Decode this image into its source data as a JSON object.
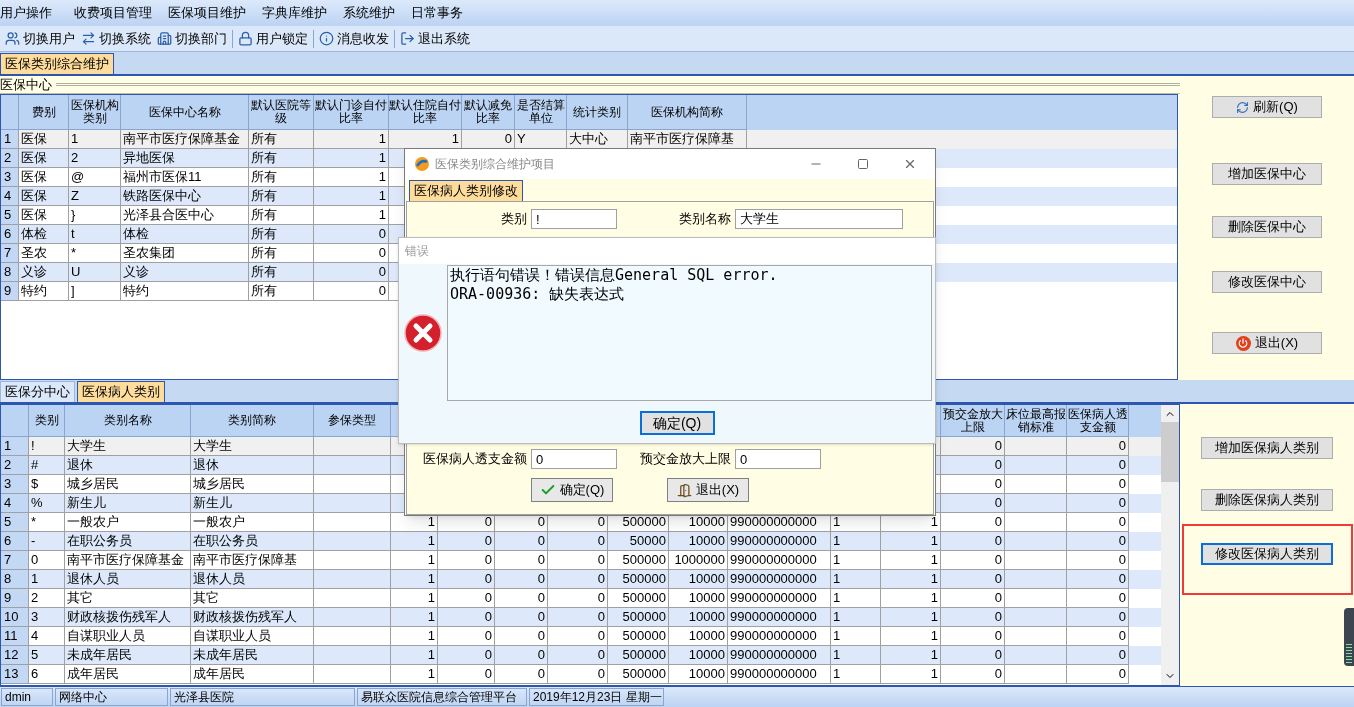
{
  "menu": [
    "用户操作",
    "收费项目管理",
    "医保项目维护",
    "字典库维护",
    "系统维护",
    "日常事务"
  ],
  "toolbar": [
    "切换用户",
    "切换系统",
    "切换部门",
    "用户锁定",
    "消息收发",
    "退出系统"
  ],
  "main_tabs": [
    {
      "label": "医保类别综合维护",
      "selected": true
    }
  ],
  "center_group": {
    "title": "医保中心",
    "columns": [
      "费别",
      "医保机构类别",
      "医保中心名称",
      "默认医院等级",
      "默认门诊自付比率",
      "默认住院自付比率",
      "默认减免比率",
      "是否结算单位",
      "统计类别",
      "医保机构简称"
    ],
    "rows": [
      {
        "no": "1",
        "selected": true,
        "cells": [
          "医保",
          "1",
          "南平市医疗保障基金",
          "所有",
          "1",
          "1",
          "0",
          "Y",
          "大中心",
          "南平市医疗保障基"
        ]
      },
      {
        "no": "2",
        "selected": false,
        "cells": [
          "医保",
          "2",
          "异地医保",
          "所有",
          "1"
        ]
      },
      {
        "no": "3",
        "selected": false,
        "cells": [
          "医保",
          "@",
          "福州市医保11",
          "所有",
          "1"
        ]
      },
      {
        "no": "4",
        "selected": false,
        "cells": [
          "医保",
          "Z",
          "铁路医保中心",
          "所有",
          "1"
        ]
      },
      {
        "no": "5",
        "selected": false,
        "cells": [
          "医保",
          "}",
          "光泽县合医中心",
          "所有",
          "1"
        ]
      },
      {
        "no": "6",
        "selected": false,
        "cells": [
          "体检",
          "t",
          "体检",
          "所有",
          "0"
        ]
      },
      {
        "no": "7",
        "selected": false,
        "cells": [
          "圣农",
          "*",
          "圣农集团",
          "所有",
          "0"
        ]
      },
      {
        "no": "8",
        "selected": false,
        "cells": [
          "义诊",
          "U",
          "义诊",
          "所有",
          "0"
        ]
      },
      {
        "no": "9",
        "selected": false,
        "cells": [
          "特约",
          "]",
          "特约",
          "所有",
          "0"
        ]
      }
    ],
    "buttons": [
      {
        "label": "刷新(Q)",
        "kind": "refresh"
      },
      {
        "label": "增加医保中心",
        "kind": "plain"
      },
      {
        "label": "删除医保中心",
        "kind": "plain"
      },
      {
        "label": "修改医保中心",
        "kind": "plain"
      },
      {
        "label": "退出(X)",
        "kind": "exit"
      }
    ]
  },
  "lower_tabs": [
    {
      "label": "医保分中心",
      "selected": false
    },
    {
      "label": "医保病人类别",
      "selected": true
    }
  ],
  "patient_types": {
    "columns": [
      "类别",
      "类别名称",
      "类别简称",
      "参保类型",
      null,
      null,
      null,
      null,
      null,
      null,
      null,
      null,
      null,
      "预交金放大上限",
      "床位最高报销标准",
      "医保病人透支金额"
    ],
    "rows": [
      {
        "no": "1",
        "selected": true,
        "cells": [
          "!",
          "大学生",
          "大学生",
          null,
          null,
          null,
          null,
          null,
          null,
          null,
          null,
          null,
          null,
          "0",
          null,
          "0"
        ]
      },
      {
        "no": "2",
        "selected": false,
        "cells": [
          "#",
          "退休",
          "退休",
          null,
          null,
          null,
          null,
          null,
          null,
          null,
          null,
          null,
          null,
          "0",
          null,
          "0"
        ]
      },
      {
        "no": "3",
        "selected": false,
        "cells": [
          "$",
          "城乡居民",
          "城乡居民",
          null,
          null,
          null,
          null,
          null,
          null,
          null,
          null,
          null,
          null,
          "0",
          null,
          "0"
        ]
      },
      {
        "no": "4",
        "selected": false,
        "cells": [
          "%",
          "新生儿",
          "新生儿",
          null,
          null,
          null,
          null,
          null,
          null,
          null,
          null,
          null,
          null,
          "0",
          null,
          "0"
        ]
      },
      {
        "no": "5",
        "selected": false,
        "cells": [
          "*",
          "一般农户",
          "一般农户",
          null,
          "1",
          "0",
          "0",
          "0",
          "500000",
          "10000",
          "990000000000",
          "1",
          "1",
          "0",
          null,
          "0"
        ]
      },
      {
        "no": "6",
        "selected": false,
        "cells": [
          "-",
          "在职公务员",
          "在职公务员",
          null,
          "1",
          "0",
          "0",
          "0",
          "50000",
          "10000",
          "990000000000",
          "1",
          "1",
          "0",
          null,
          "0"
        ]
      },
      {
        "no": "7",
        "selected": false,
        "cells": [
          "0",
          "南平市医疗保障基金",
          "南平市医疗保障基",
          null,
          "1",
          "0",
          "0",
          "0",
          "500000",
          "1000000",
          "990000000000",
          "1",
          "1",
          "0",
          null,
          "0"
        ]
      },
      {
        "no": "8",
        "selected": false,
        "cells": [
          "1",
          "退休人员",
          "退休人员",
          null,
          "1",
          "0",
          "0",
          "0",
          "500000",
          "10000",
          "990000000000",
          "1",
          "1",
          "0",
          null,
          "0"
        ]
      },
      {
        "no": "9",
        "selected": false,
        "cells": [
          "2",
          "其它",
          "其它",
          null,
          "1",
          "0",
          "0",
          "0",
          "500000",
          "10000",
          "990000000000",
          "1",
          "1",
          "0",
          null,
          "0"
        ]
      },
      {
        "no": "10",
        "selected": false,
        "cells": [
          "3",
          "财政核拨伤残军人",
          "财政核拨伤残军人",
          null,
          "1",
          "0",
          "0",
          "0",
          "500000",
          "10000",
          "990000000000",
          "1",
          "1",
          "0",
          null,
          "0"
        ]
      },
      {
        "no": "11",
        "selected": false,
        "cells": [
          "4",
          "自谋职业人员",
          "自谋职业人员",
          null,
          "1",
          "0",
          "0",
          "0",
          "500000",
          "10000",
          "990000000000",
          "1",
          "1",
          "0",
          null,
          "0"
        ]
      },
      {
        "no": "12",
        "selected": false,
        "cells": [
          "5",
          "未成年居民",
          "未成年居民",
          null,
          "1",
          "0",
          "0",
          "0",
          "500000",
          "10000",
          "990000000000",
          "1",
          "1",
          "0",
          null,
          "0"
        ]
      },
      {
        "no": "13",
        "selected": false,
        "cells": [
          "6",
          "成年居民",
          "成年居民",
          null,
          "1",
          "0",
          "0",
          "0",
          "500000",
          "10000",
          "990000000000",
          "1",
          "1",
          "0",
          null,
          "0"
        ]
      }
    ],
    "buttons": [
      {
        "label": "增加医保病人类别",
        "focused": false,
        "annotated": false
      },
      {
        "label": "删除医保病人类别",
        "focused": false,
        "annotated": false
      },
      {
        "label": "修改医保病人类别",
        "focused": true,
        "annotated": true
      }
    ]
  },
  "edit_dialog": {
    "title": "医保类别综合维护项目",
    "tabs": [
      {
        "label": "医保病人类别修改",
        "selected": true
      }
    ],
    "fields": [
      {
        "label": "类别",
        "value": "!"
      },
      {
        "label": "类别名称",
        "value": "大学生"
      },
      {
        "label": "医保病人透支金额",
        "value": "0"
      },
      {
        "label": "预交金放大上限",
        "value": "0"
      }
    ],
    "buttons": [
      {
        "label": "确定(Q)",
        "kind": "ok"
      },
      {
        "label": "退出(X)",
        "kind": "exit"
      }
    ]
  },
  "error_dialog": {
    "title": "错误",
    "message": [
      "执行语句错误！错误信息General SQL error.",
      "ORA-00936: 缺失表达式"
    ],
    "button": "确定(Q)"
  },
  "status_bar": [
    "dmin",
    "网络中心",
    "光泽县医院",
    "易联众医院信息综合管理平台",
    "2019年12月23日 星期一"
  ]
}
